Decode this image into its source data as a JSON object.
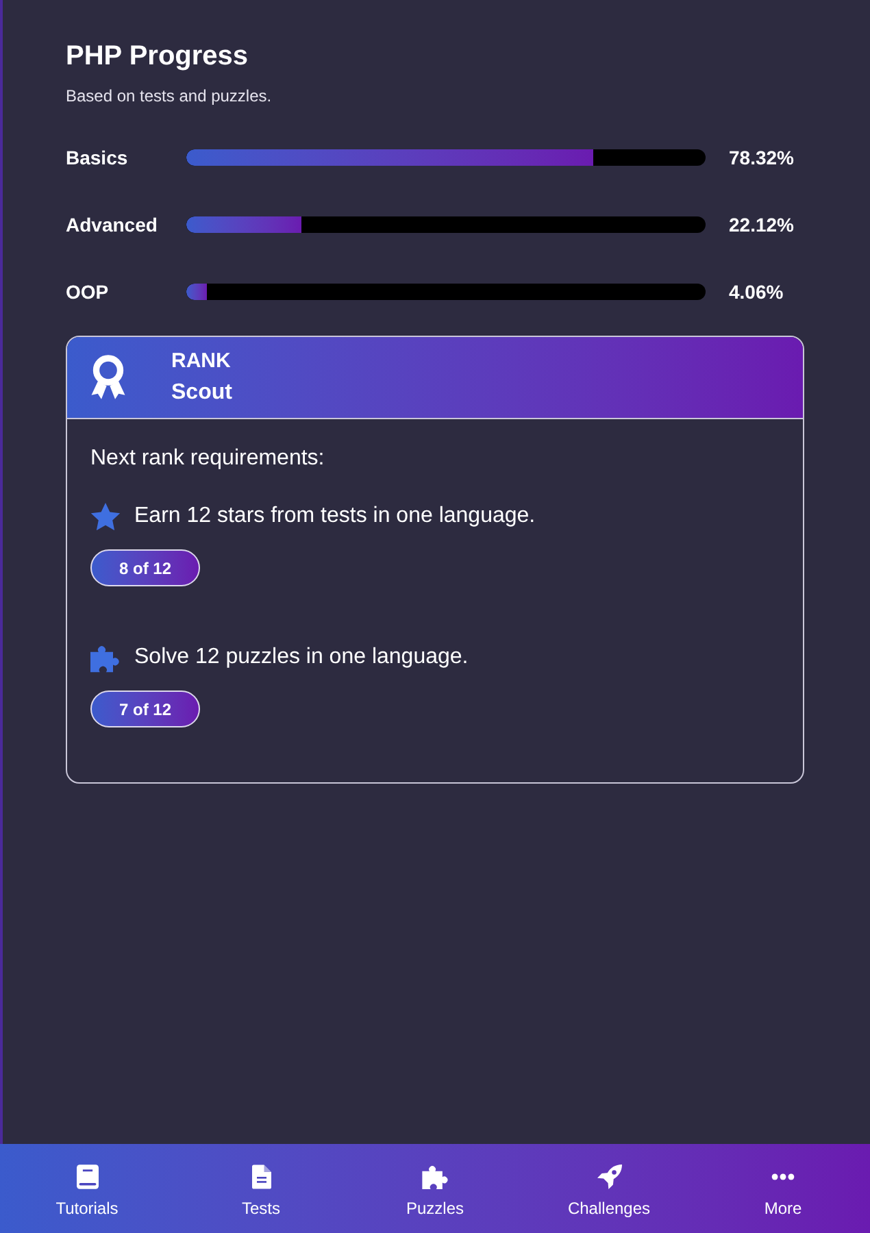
{
  "header": {
    "title": "PHP Progress",
    "subtitle": "Based on tests and puzzles."
  },
  "progress": [
    {
      "label": "Basics",
      "level": 0.7832,
      "reading": "78.32%"
    },
    {
      "label": "Advanced",
      "level": 0.2212,
      "reading": "22.12%"
    },
    {
      "label": "OOP",
      "level": 0.0406,
      "reading": "4.06%"
    }
  ],
  "rank_card": {
    "heading": "RANK",
    "rank": "Scout",
    "requirements_title": "Next rank requirements:",
    "requirements": [
      {
        "kind": "stars",
        "text": "Earn 12 stars from tests in one language.",
        "badge": "8 of 12"
      },
      {
        "kind": "puzzles",
        "text": "Solve 12 puzzles in one language.",
        "badge": "7 of 12"
      }
    ]
  },
  "bottom_nav": [
    {
      "kind": "book",
      "label": "Tutorials"
    },
    {
      "kind": "document",
      "label": "Tests"
    },
    {
      "kind": "puzzle",
      "label": "Puzzles"
    },
    {
      "kind": "rocket",
      "label": "Challenges"
    },
    {
      "kind": "more",
      "label": "More"
    }
  ]
}
